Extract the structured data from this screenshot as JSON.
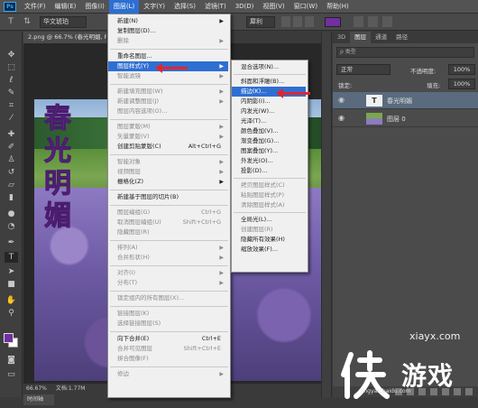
{
  "app": {
    "logo": "Ps"
  },
  "menubar": {
    "items": [
      "文件(F)",
      "编辑(E)",
      "图像(I)",
      "图层(L)",
      "文字(Y)",
      "选择(S)",
      "滤镜(T)",
      "3D(D)",
      "视图(V)",
      "窗口(W)",
      "帮助(H)"
    ],
    "active_index": 3
  },
  "options_bar": {
    "font": "华文琥珀",
    "antialias": "犀利",
    "text_color": "#7030a0"
  },
  "document": {
    "tab_title": "2.png @ 66.7% (春光明媚, R...",
    "vertical_text": "春光明媚",
    "text_color": "#7b3aa8"
  },
  "status": {
    "zoom": "66.67%",
    "doc_size": "文档:1.77M"
  },
  "timeline_label": "时间轴",
  "layer_menu": {
    "items": [
      {
        "label": "新建(N)",
        "submenu": true
      },
      {
        "label": "复制图层(D)..."
      },
      {
        "label": "删除",
        "submenu": true,
        "disabled": true
      },
      {
        "sep": true
      },
      {
        "label": "重命名图层..."
      },
      {
        "label": "图层样式(Y)",
        "submenu": true,
        "highlighted": true
      },
      {
        "label": "智能滤镜",
        "submenu": true,
        "disabled": true
      },
      {
        "sep": true
      },
      {
        "label": "新建填充图层(W)",
        "submenu": true,
        "disabled": true
      },
      {
        "label": "新建调整图层(J)",
        "submenu": true,
        "disabled": true
      },
      {
        "label": "图层内容选项(O)...",
        "disabled": true
      },
      {
        "sep": true
      },
      {
        "label": "图层蒙版(M)",
        "submenu": true,
        "disabled": true
      },
      {
        "label": "矢量蒙版(V)",
        "submenu": true,
        "disabled": true
      },
      {
        "label": "创建剪贴蒙版(C)",
        "shortcut": "Alt+Ctrl+G"
      },
      {
        "sep": true
      },
      {
        "label": "智能对象",
        "submenu": true,
        "disabled": true
      },
      {
        "label": "视频图层",
        "submenu": true,
        "disabled": true
      },
      {
        "label": "栅格化(Z)",
        "submenu": true
      },
      {
        "sep": true
      },
      {
        "label": "新建基于图层的切片(B)"
      },
      {
        "sep": true
      },
      {
        "label": "图层编组(G)",
        "shortcut": "Ctrl+G",
        "disabled": true
      },
      {
        "label": "取消图层编组(U)",
        "shortcut": "Shift+Ctrl+G",
        "disabled": true
      },
      {
        "label": "隐藏图层(R)",
        "disabled": true
      },
      {
        "sep": true
      },
      {
        "label": "排列(A)",
        "submenu": true,
        "disabled": true
      },
      {
        "label": "合并形状(H)",
        "submenu": true,
        "disabled": true
      },
      {
        "sep": true
      },
      {
        "label": "对齐(I)",
        "submenu": true,
        "disabled": true
      },
      {
        "label": "分布(T)",
        "submenu": true,
        "disabled": true
      },
      {
        "sep": true
      },
      {
        "label": "锁定组内的所有图层(X)...",
        "disabled": true
      },
      {
        "sep": true
      },
      {
        "label": "链接图层(K)",
        "disabled": true
      },
      {
        "label": "选择链接图层(S)",
        "disabled": true
      },
      {
        "sep": true
      },
      {
        "label": "向下合并(E)",
        "shortcut": "Ctrl+E"
      },
      {
        "label": "合并可见图层",
        "shortcut": "Shift+Ctrl+E",
        "disabled": true
      },
      {
        "label": "拼合图像(F)",
        "disabled": true
      },
      {
        "sep": true
      },
      {
        "label": "修边",
        "submenu": true,
        "disabled": true
      }
    ]
  },
  "style_menu": {
    "items": [
      {
        "label": "混合选项(N)..."
      },
      {
        "sep": true
      },
      {
        "label": "斜面和浮雕(B)..."
      },
      {
        "label": "描边(K)...",
        "highlighted": true
      },
      {
        "label": "内阴影(I)..."
      },
      {
        "label": "内发光(W)..."
      },
      {
        "label": "光泽(T)..."
      },
      {
        "label": "颜色叠加(V)..."
      },
      {
        "label": "渐变叠加(G)..."
      },
      {
        "label": "图案叠加(Y)..."
      },
      {
        "label": "外发光(O)..."
      },
      {
        "label": "投影(D)..."
      },
      {
        "sep": true
      },
      {
        "label": "拷贝图层样式(C)",
        "disabled": true
      },
      {
        "label": "粘贴图层样式(P)",
        "disabled": true
      },
      {
        "label": "清除图层样式(A)",
        "disabled": true
      },
      {
        "sep": true
      },
      {
        "label": "全局光(L)..."
      },
      {
        "label": "创建图层(R)",
        "disabled": true
      },
      {
        "label": "隐藏所有效果(H)"
      },
      {
        "label": "缩放效果(F)..."
      }
    ]
  },
  "layers_panel": {
    "tabs": [
      "3D",
      "图层",
      "通道",
      "路径"
    ],
    "active_tab": 1,
    "filter_label": "ρ 类型",
    "blend_mode": "正常",
    "opacity_label": "不透明度:",
    "opacity": "100%",
    "lock_label": "锁定:",
    "fill_label": "填充:",
    "fill": "100%",
    "layers": [
      {
        "name": "春光明媚",
        "type": "text",
        "thumb_glyph": "T",
        "selected": true
      },
      {
        "name": "图层 0",
        "type": "image",
        "selected": false
      }
    ]
  },
  "watermark": {
    "site": "xiayx.com",
    "name": "游戏",
    "small": "jingyan.baidu.com"
  }
}
